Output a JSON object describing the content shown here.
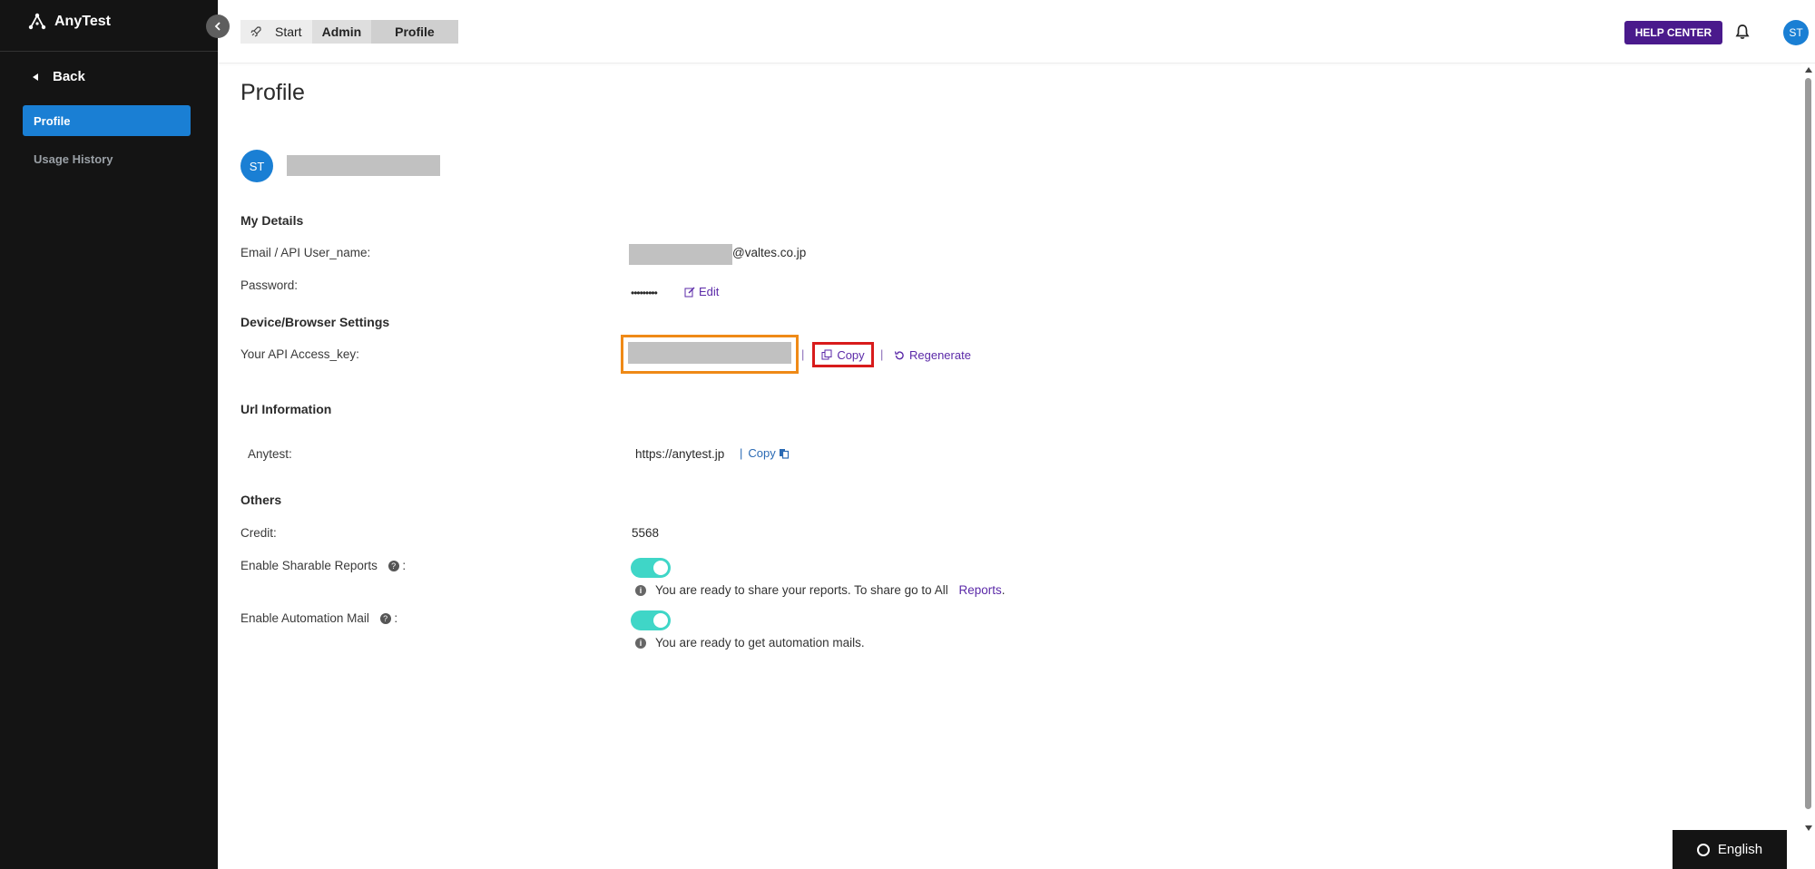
{
  "app": {
    "name": "AnyTest"
  },
  "sidebar": {
    "back_label": "Back",
    "items": [
      {
        "label": "Profile",
        "active": true
      },
      {
        "label": "Usage History",
        "active": false
      }
    ]
  },
  "topbar": {
    "breadcrumb": [
      "Start",
      "Admin",
      "Profile"
    ],
    "help_label": "HELP CENTER",
    "avatar_initials": "ST"
  },
  "profile": {
    "title": "Profile",
    "avatar_initials": "ST",
    "sections": {
      "my_details": "My Details",
      "device_browser": "Device/Browser Settings",
      "url_info": "Url Information",
      "others": "Others"
    },
    "email_label": "Email / API User_name:",
    "email_suffix": "@valtes.co.jp",
    "password_label": "Password:",
    "password_mask": "•••••••••",
    "edit_label": "Edit",
    "api_key_label": "Your API Access_key:",
    "copy_label": "Copy",
    "regenerate_label": "Regenerate",
    "anytest_label": "Anytest:",
    "anytest_url": "https://anytest.jp",
    "url_copy_label": "Copy",
    "credit_label": "Credit:",
    "credit_value": "5568",
    "sharable_label": "Enable Sharable Reports",
    "sharable_enabled": true,
    "sharable_note": "You are ready to share your reports. To share go to All",
    "sharable_link": "Reports",
    "automation_label": "Enable Automation Mail",
    "automation_enabled": true,
    "automation_note": "You are ready to get automation mails."
  },
  "language": {
    "label": "English"
  },
  "colors": {
    "accent_blue": "#1a7fd4",
    "help_purple": "#4a1a8c",
    "link_purple": "#5b2aa8",
    "toggle_teal": "#3fd6c7",
    "highlight_orange": "#ef8a17",
    "highlight_red": "#d81b1b"
  }
}
